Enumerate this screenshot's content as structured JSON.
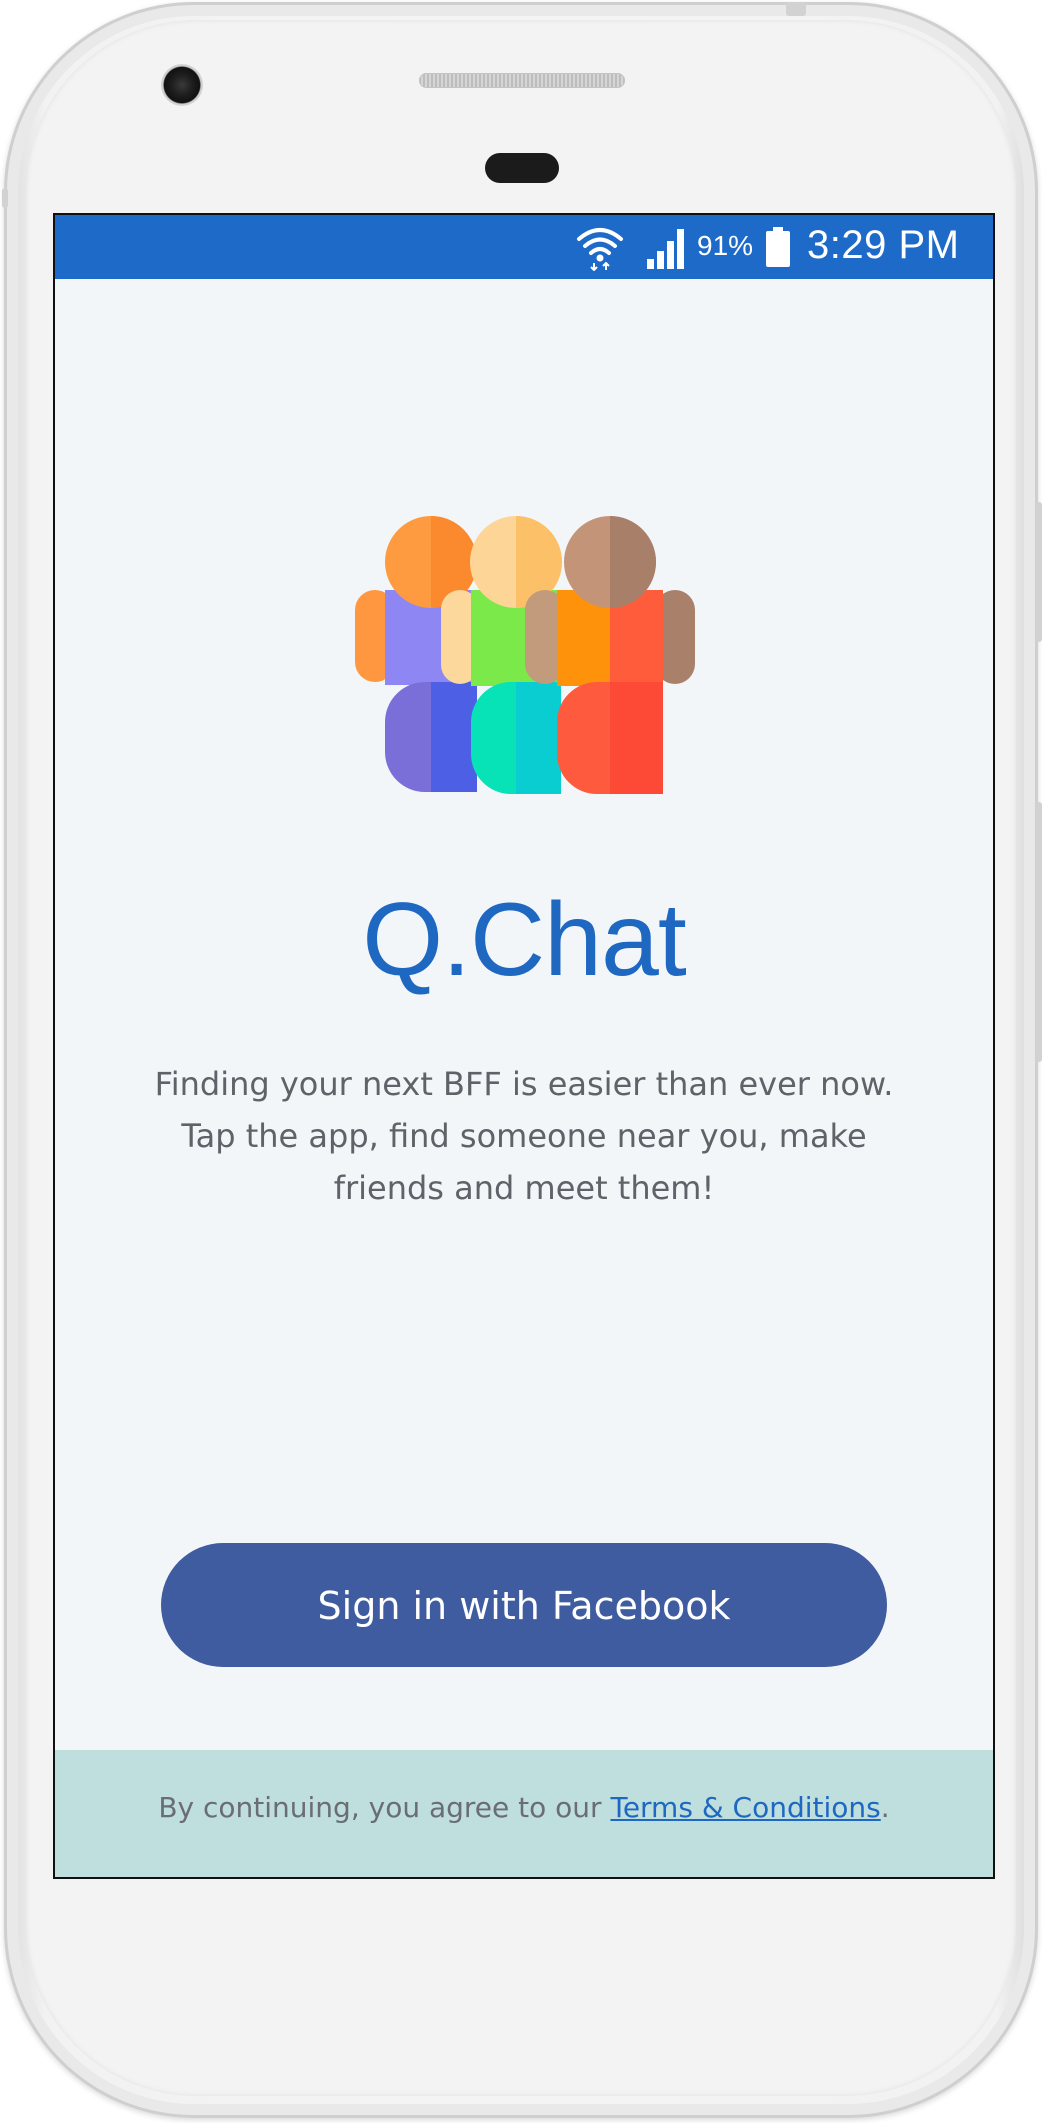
{
  "status_bar": {
    "battery_percent": "91%",
    "time": "3:29 PM",
    "icons": [
      "wifi-icon",
      "cell-signal-icon",
      "battery-icon"
    ],
    "background_color": "#1e6ac8"
  },
  "app": {
    "title": "Q.Chat",
    "title_color": "#1f68c2",
    "logo_icon": "group-of-friends-logo",
    "tagline_lines": [
      "Finding your next BFF is easier than ever now.",
      "Tap the app, find someone near you, make",
      "friends and meet them!"
    ]
  },
  "signin": {
    "button_label": "Sign in with Facebook",
    "button_color": "#3e5c9f"
  },
  "footer": {
    "prefix": "By continuing, you agree to our ",
    "link_label": "Terms & Conditions",
    "suffix": ".",
    "background_color": "#bfdfdf"
  }
}
